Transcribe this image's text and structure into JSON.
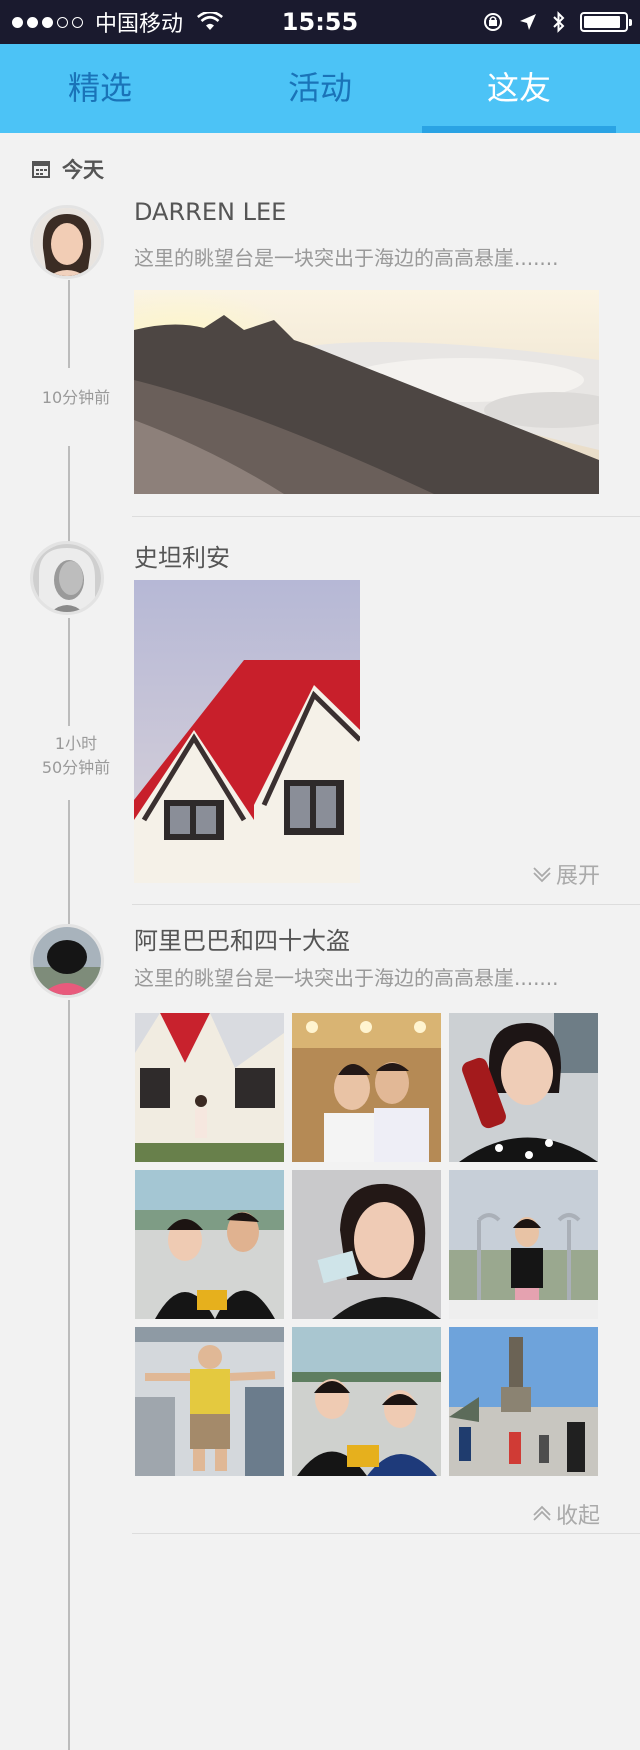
{
  "status_bar": {
    "carrier": "中国移动",
    "time": "15:55",
    "battery_level": 0.9
  },
  "tabs": [
    {
      "label": "精选",
      "active": false
    },
    {
      "label": "活动",
      "active": false
    },
    {
      "label": "这友",
      "active": true
    }
  ],
  "feed": {
    "date_label": "今天",
    "posts": [
      {
        "author": "DARREN LEE",
        "text": "这里的眺望台是一块突出于海边的高高悬崖.......",
        "time": "10分钟前",
        "avatar_icon": "woman-portrait",
        "photos": [
          "mountain-sunset-clouds"
        ]
      },
      {
        "author": "史坦利安",
        "time_line1": "1小时",
        "time_line2": "50分钟前",
        "avatar_icon": "woman-portrait-bw",
        "photos": [
          "red-roof-house"
        ],
        "expand_label": "展开"
      },
      {
        "author": "阿里巴巴和四十大盗",
        "text": "这里的眺望台是一块突出于海边的高高悬崖.......",
        "avatar_icon": "child-portrait",
        "photos": [
          "house-girl",
          "banquet-couple",
          "girl-cola",
          "couple-boat",
          "girl-ticket",
          "girl-boat",
          "man-office",
          "girls-boat",
          "square-monument"
        ],
        "collapse_label": "收起"
      }
    ]
  },
  "colors": {
    "nav_bg": "#4cc3f6",
    "tab_inactive": "#1a73b8",
    "tab_active": "#ffffff",
    "underline": "#2aa3e4",
    "page_bg": "#f2f2f2"
  }
}
